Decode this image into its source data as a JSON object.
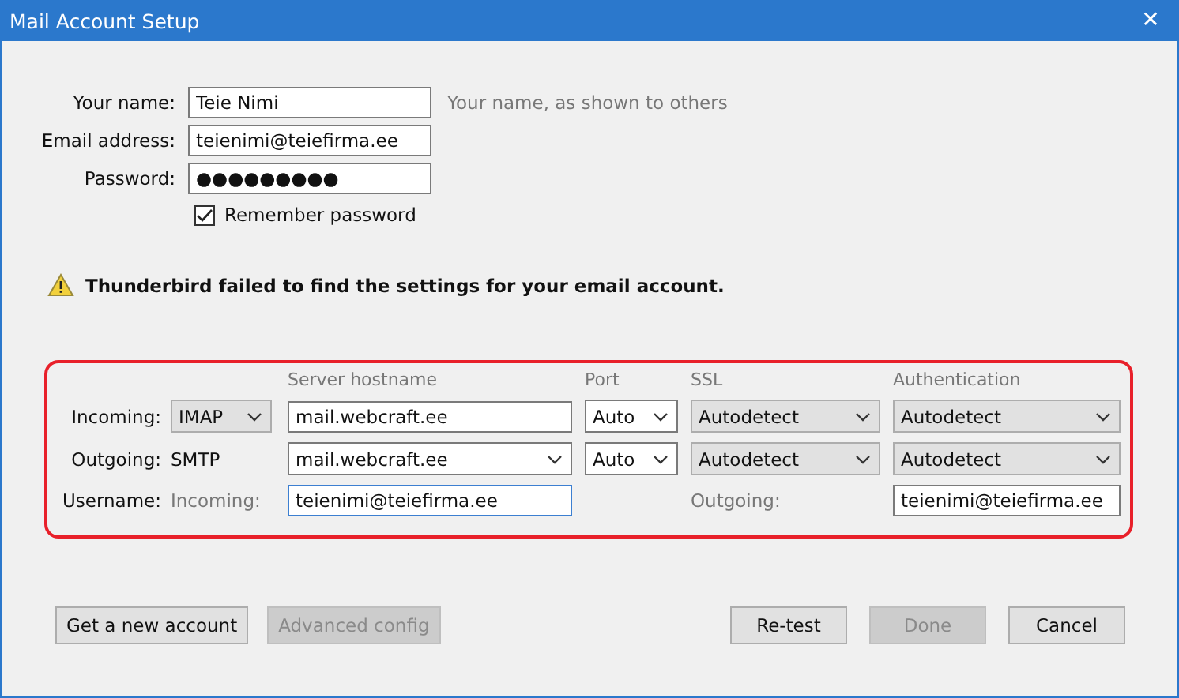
{
  "window": {
    "title": "Mail Account Setup",
    "close": "✕"
  },
  "identity": [
    {
      "label": "Your name:",
      "value": "Teie Nimi",
      "hint": "Your name, as shown to others"
    },
    {
      "label": "Email address:",
      "value": "teienimi@teiefirma.ee"
    },
    {
      "label": "Password:",
      "value": "●●●●●●●●●"
    }
  ],
  "remember_password": {
    "label": "Remember password",
    "checked": true
  },
  "warning": "Thunderbird failed to find the settings for your email account.",
  "server_settings": {
    "columns": [
      "",
      "Server hostname",
      "Port",
      "SSL",
      "Authentication"
    ],
    "rows": [
      {
        "label": "Incoming:",
        "cells": [
          {
            "kind": "dropdown",
            "value": "IMAP"
          },
          {
            "kind": "text",
            "value": "mail.webcraft.ee"
          },
          {
            "kind": "combo",
            "value": "Auto"
          },
          {
            "kind": "dropdown",
            "value": "Autodetect"
          },
          {
            "kind": "dropdown",
            "value": "Autodetect"
          }
        ]
      },
      {
        "label": "Outgoing:",
        "cells": [
          {
            "kind": "plain",
            "value": "SMTP"
          },
          {
            "kind": "combo",
            "value": "mail.webcraft.ee"
          },
          {
            "kind": "combo",
            "value": "Auto"
          },
          {
            "kind": "dropdown",
            "value": "Autodetect"
          },
          {
            "kind": "dropdown",
            "value": "Autodetect"
          }
        ]
      }
    ],
    "username": {
      "label": "Username:",
      "incoming_label": "Incoming:",
      "incoming": "teienimi@teiefirma.ee",
      "incoming_focused": true,
      "outgoing_label": "Outgoing:",
      "outgoing": "teienimi@teiefirma.ee"
    }
  },
  "buttons_left": [
    {
      "label": "Get a new account",
      "disabled": false
    },
    {
      "label": "Advanced config",
      "disabled": true
    }
  ],
  "buttons_right": [
    {
      "label": "Re-test",
      "disabled": false
    },
    {
      "label": "Done",
      "disabled": true
    },
    {
      "label": "Cancel",
      "disabled": false
    }
  ]
}
